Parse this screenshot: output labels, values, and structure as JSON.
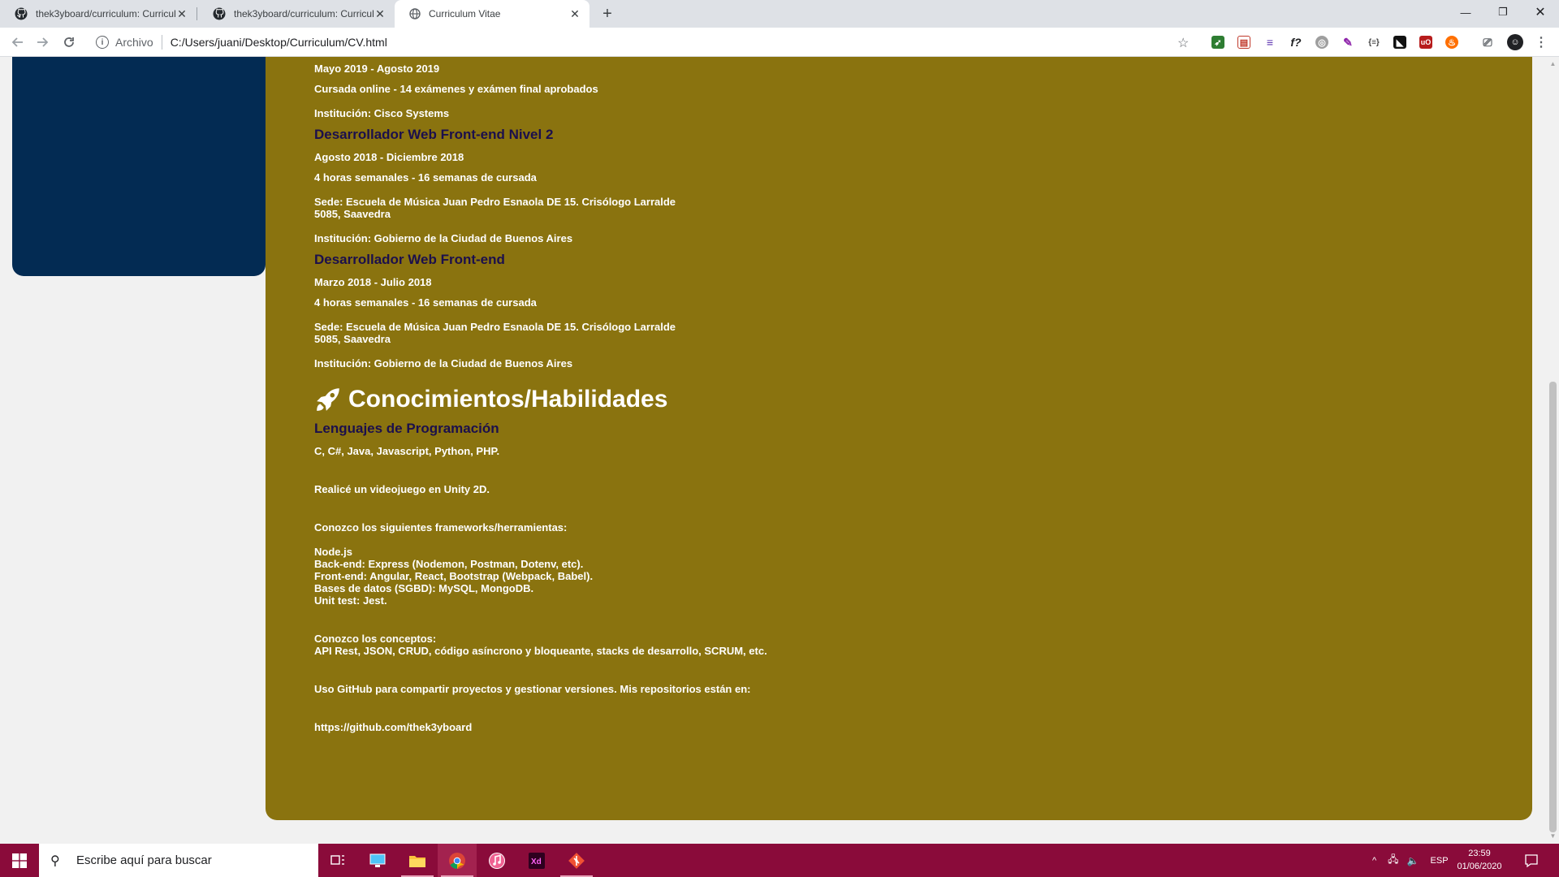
{
  "browser": {
    "tabs": [
      {
        "label": "thek3yboard/curriculum: Curricul",
        "icon": "github-icon"
      },
      {
        "label": "thek3yboard/curriculum: Curricul",
        "icon": "github-icon"
      },
      {
        "label": "Curriculum Vitae",
        "icon": "globe-icon"
      }
    ],
    "address": {
      "scheme": "Archivo",
      "url": "C:/Users/juani/Desktop/Curriculum/CV.html"
    }
  },
  "page": {
    "lines": [
      "Mayo 2019 - Agosto 2019",
      "Cursada online - 14 exámenes y exámen final aprobados",
      "Institución: Cisco Systems",
      "Desarrollador Web Front-end Nivel 2",
      "Agosto 2018 - Diciembre 2018",
      "4 horas semanales - 16 semanas de cursada",
      "Sede: Escuela de Música Juan Pedro Esnaola DE 15. Crisólogo Larralde",
      "5085, Saavedra",
      "Institución: Gobierno de la Ciudad de Buenos Aires",
      "Desarrollador Web Front-end",
      "Marzo 2018 - Julio 2018",
      "4 horas semanales - 16 semanas de cursada",
      "Sede: Escuela de Música Juan Pedro Esnaola DE 15. Crisólogo Larralde",
      "5085, Saavedra",
      "Institución: Gobierno de la Ciudad de Buenos Aires"
    ],
    "skills_section": {
      "title": "Conocimientos/Habilidades",
      "subtitle": "Lenguajes de Programación",
      "lines": [
        "C, C#, Java, Javascript, Python, PHP.",
        "Realicé un videojuego en Unity 2D.",
        "Conozco los siguientes frameworks/herramientas:",
        "Node.js",
        "Back-end: Express (Nodemon, Postman, Dotenv, etc).",
        "Front-end: Angular, React, Bootstrap (Webpack, Babel).",
        "Bases de datos (SGBD): MySQL, MongoDB.",
        "Unit test: Jest.",
        "Conozco los conceptos:",
        "API Rest, JSON, CRUD, código asíncrono y bloqueante, stacks de desarrollo, SCRUM, etc.",
        "Uso GitHub para compartir proyectos y gestionar versiones. Mis repositorios están en:",
        "https://github.com/thek3yboard"
      ]
    }
  },
  "taskbar": {
    "search_placeholder": "Escribe aquí para buscar",
    "language": "ESP",
    "time": "23:59",
    "date": "01/06/2020"
  },
  "colors": {
    "main_card": "#8a730f",
    "sidebar_card": "#032b53",
    "course_title": "#1b0f4c",
    "taskbar": "#8a0b3a"
  }
}
